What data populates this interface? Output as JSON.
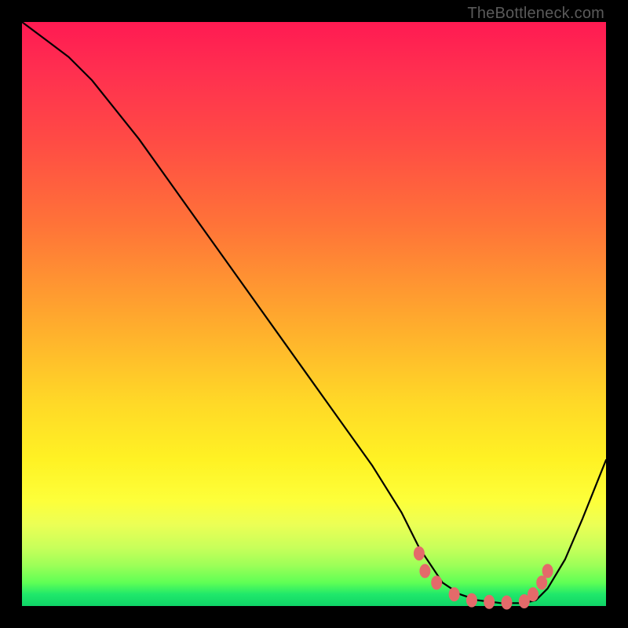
{
  "attribution": "TheBottleneck.com",
  "chart_data": {
    "type": "line",
    "title": "",
    "xlabel": "",
    "ylabel": "",
    "xlim": [
      0,
      100
    ],
    "ylim": [
      0,
      100
    ],
    "grid": false,
    "legend": false,
    "series": [
      {
        "name": "bottleneck-curve",
        "x": [
          0,
          4,
          8,
          12,
          16,
          20,
          25,
          30,
          35,
          40,
          45,
          50,
          55,
          60,
          65,
          68,
          70,
          72,
          75,
          78,
          82,
          86,
          88,
          90,
          93,
          96,
          100
        ],
        "y": [
          100,
          97,
          94,
          90,
          85,
          80,
          73,
          66,
          59,
          52,
          45,
          38,
          31,
          24,
          16,
          10,
          7,
          4,
          2,
          1,
          0.5,
          0.5,
          1,
          3,
          8,
          15,
          25
        ]
      }
    ],
    "markers": {
      "name": "highlighted-range",
      "points": [
        {
          "x": 68,
          "y": 9
        },
        {
          "x": 69,
          "y": 6
        },
        {
          "x": 71,
          "y": 4
        },
        {
          "x": 74,
          "y": 2
        },
        {
          "x": 77,
          "y": 1
        },
        {
          "x": 80,
          "y": 0.7
        },
        {
          "x": 83,
          "y": 0.6
        },
        {
          "x": 86,
          "y": 0.8
        },
        {
          "x": 87.5,
          "y": 2
        },
        {
          "x": 89,
          "y": 4
        },
        {
          "x": 90,
          "y": 6
        }
      ]
    },
    "background_gradient": {
      "top": "#ff1a52",
      "mid_upper": "#ff7438",
      "mid": "#ffd827",
      "mid_lower": "#fdff3a",
      "bottom": "#0fd467"
    }
  }
}
